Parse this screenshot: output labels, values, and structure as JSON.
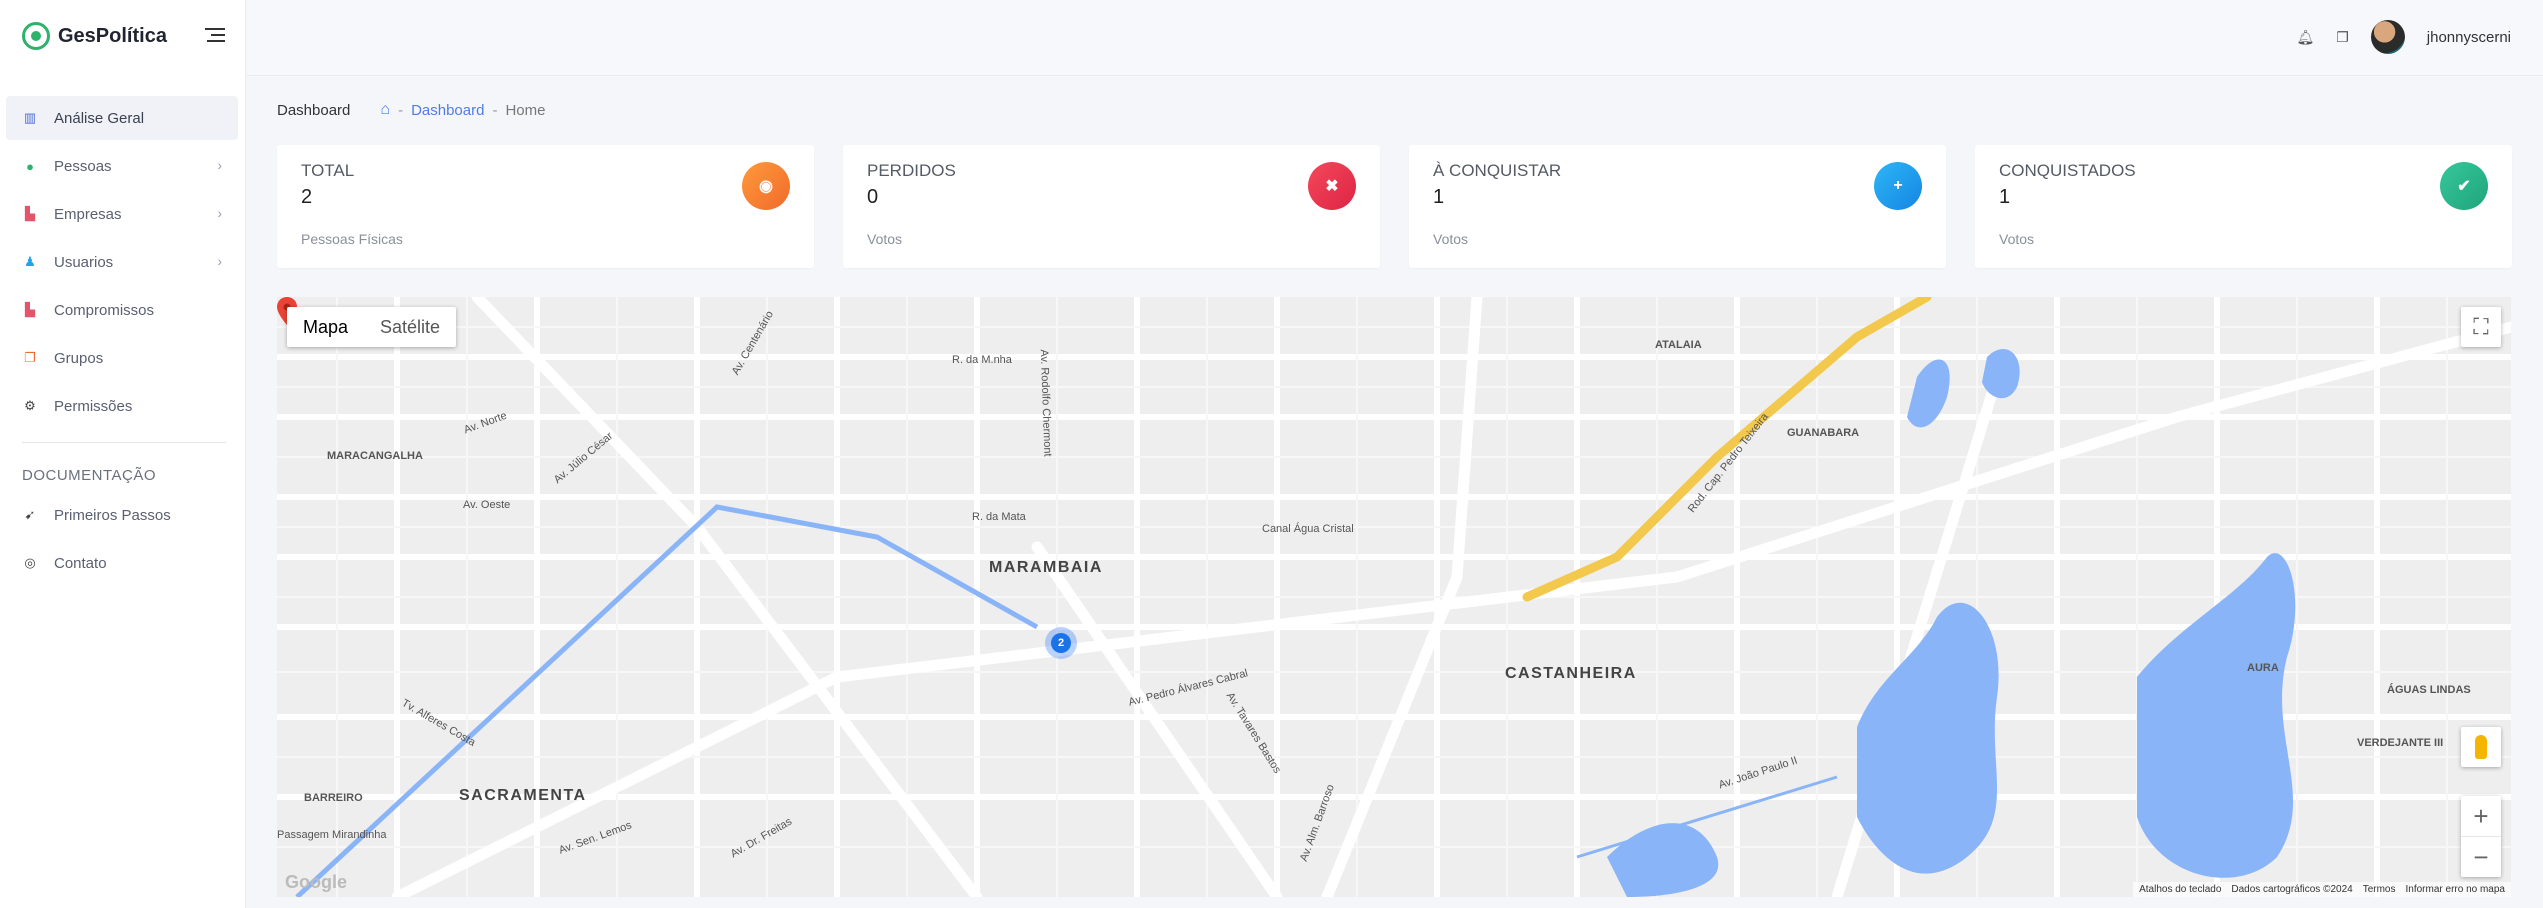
{
  "brand": {
    "name": "GesPolítica"
  },
  "sidebar": {
    "items": [
      {
        "label": "Análise Geral",
        "icon": "building-icon"
      },
      {
        "label": "Pessoas",
        "icon": "person-icon"
      },
      {
        "label": "Empresas",
        "icon": "factory-icon"
      },
      {
        "label": "Usuarios",
        "icon": "user-icon"
      },
      {
        "label": "Compromissos",
        "icon": "calendar-icon"
      },
      {
        "label": "Grupos",
        "icon": "copy-icon"
      },
      {
        "label": "Permissões",
        "icon": "gear-icon"
      }
    ],
    "section_title": "DOCUMENTAÇÃO",
    "doc_items": [
      {
        "label": "Primeiros Passos",
        "icon": "rocket-icon"
      },
      {
        "label": "Contato",
        "icon": "globe-icon"
      }
    ]
  },
  "topbar": {
    "username": "jhonnyscerni"
  },
  "breadcrumb": {
    "page": "Dashboard",
    "link": "Dashboard",
    "current": "Home",
    "separator": "-"
  },
  "cards": [
    {
      "title": "TOTAL",
      "value": "2",
      "caption": "Pessoas Físicas",
      "color": "#f37c33",
      "icon": "user-circle-icon"
    },
    {
      "title": "PERDIDOS",
      "value": "0",
      "caption": "Votos",
      "color": "#e73550",
      "icon": "close-icon"
    },
    {
      "title": "À CONQUISTAR",
      "value": "1",
      "caption": "Votos",
      "color": "#1f9cec",
      "icon": "plus-icon"
    },
    {
      "title": "CONQUISTADOS",
      "value": "1",
      "caption": "Votos",
      "color": "#29b68a",
      "icon": "check-icon"
    }
  ],
  "map": {
    "toggle": {
      "map": "Mapa",
      "satellite": "Satélite"
    },
    "cluster_count": "2",
    "labels": {
      "marambaia": "MARAMBAIA",
      "castanheira": "CASTANHEIRA",
      "sacramenta": "SACRAMENTA",
      "guanabara": "GUANABARA",
      "atalaia": "ATALAIA",
      "aura": "AURA",
      "maracangalha": "MARACANGALHA",
      "barreiro": "BARREIRO",
      "aguas_lindas": "ÁGUAS LINDAS",
      "verdejante": "VERDEJANTE III",
      "av_pedro_alvares": "Av. Pedro Álvares Cabral",
      "av_tavares_bastos": "Av. Tavares Bastos",
      "av_julio_cesar": "Av. Júlio César",
      "rod_cap_pedro": "Rod. Cap. Pedro Teixeira",
      "av_joao_paulo": "Av. João Paulo II",
      "av_alm_barroso": "Av. Alm. Barroso",
      "r_da_mata": "R. da Mata",
      "r_da_mnha": "R. da M.nha",
      "canal_agua_cristal": "Canal Água Cristal",
      "av_centenario": "Av. Centenário",
      "av_oeste": "Av. Oeste",
      "av_norte": "Av. Norte",
      "av_rodolfo": "Av. Rodolfo Chermont",
      "av_dr_freitas": "Av. Dr. Freitas",
      "av_sen_lemos": "Av. Sen. Lemos",
      "passagem_mirandinha": "Passagem Mirandinha",
      "tv_alferes_costa": "Tv. Alferes Costa"
    },
    "footer": {
      "shortcuts": "Atalhos do teclado",
      "data": "Dados cartográficos ©2024",
      "terms": "Termos",
      "report": "Informar erro no mapa"
    },
    "google_logo": "Google"
  }
}
